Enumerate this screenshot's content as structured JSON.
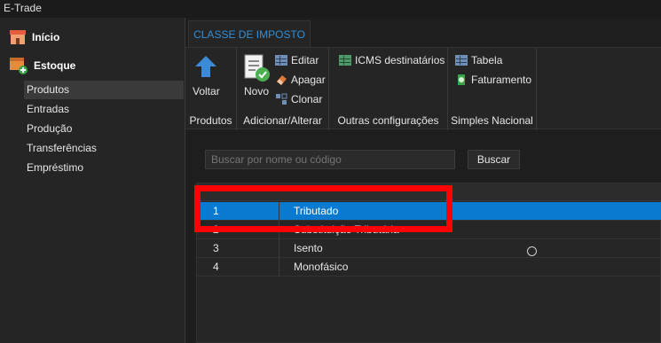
{
  "app": {
    "title": "E-Trade"
  },
  "sidebar": {
    "main": [
      {
        "label": "Início",
        "icon": "store-icon"
      },
      {
        "label": "Estoque",
        "icon": "box-add-icon"
      }
    ],
    "sub": [
      "Produtos",
      "Entradas",
      "Produção",
      "Transferências",
      "Empréstimo"
    ]
  },
  "tab": {
    "label": "CLASSE DE IMPOSTO"
  },
  "ribbon": {
    "groups": {
      "produtos": {
        "label": "Produtos",
        "voltar": "Voltar"
      },
      "adicionar": {
        "label": "Adicionar/Alterar",
        "novo": "Novo",
        "editar": "Editar",
        "apagar": "Apagar",
        "clonar": "Clonar"
      },
      "outras": {
        "label": "Outras configurações",
        "icms": "ICMS destinatários"
      },
      "simples": {
        "label": "Simples Nacional",
        "tabela": "Tabela",
        "faturamento": "Faturamento"
      }
    }
  },
  "search": {
    "placeholder": "Buscar por nome ou código",
    "button": "Buscar"
  },
  "grid": {
    "rows": [
      {
        "id": "1",
        "name": "Tributado"
      },
      {
        "id": "2",
        "name": "Substituição Tributária"
      },
      {
        "id": "3",
        "name": "Isento"
      },
      {
        "id": "4",
        "name": "Monofásico"
      }
    ]
  },
  "colors": {
    "accent": "#0a7ad0",
    "tab_text": "#2f8fd8",
    "highlight": "#ff0000"
  }
}
